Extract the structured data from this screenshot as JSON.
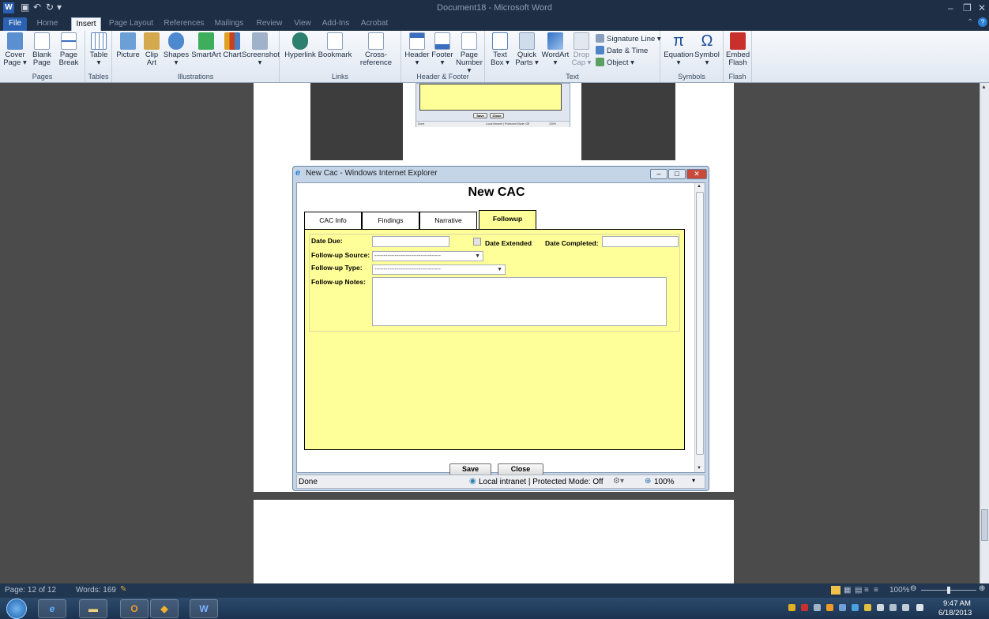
{
  "window": {
    "title": "Document18 - Microsoft Word",
    "app_icon": "W",
    "qa_icons": [
      "save-icon",
      "undo-icon",
      "redo-icon",
      "customize-icon"
    ]
  },
  "tabs": [
    "File",
    "Home",
    "Insert",
    "Page Layout",
    "References",
    "Mailings",
    "Review",
    "View",
    "Add-Ins",
    "Acrobat"
  ],
  "ribbon": {
    "groups": [
      {
        "label": "Pages",
        "buttons": [
          {
            "l1": "Cover",
            "l2": "Page ▾"
          },
          {
            "l1": "Blank",
            "l2": "Page"
          },
          {
            "l1": "Page",
            "l2": "Break"
          }
        ]
      },
      {
        "label": "Tables",
        "buttons": [
          {
            "l1": "Table",
            "l2": "▾"
          }
        ]
      },
      {
        "label": "Illustrations",
        "buttons": [
          {
            "l1": "Picture",
            "l2": ""
          },
          {
            "l1": "Clip",
            "l2": "Art"
          },
          {
            "l1": "Shapes",
            "l2": "▾"
          },
          {
            "l1": "SmartArt",
            "l2": ""
          },
          {
            "l1": "Chart",
            "l2": ""
          },
          {
            "l1": "Screenshot",
            "l2": "▾"
          }
        ]
      },
      {
        "label": "Links",
        "buttons": [
          {
            "l1": "Hyperlink",
            "l2": ""
          },
          {
            "l1": "Bookmark",
            "l2": ""
          },
          {
            "l1": "Cross-reference",
            "l2": ""
          }
        ]
      },
      {
        "label": "Header & Footer",
        "buttons": [
          {
            "l1": "Header",
            "l2": "▾"
          },
          {
            "l1": "Footer",
            "l2": "▾"
          },
          {
            "l1": "Page",
            "l2": "Number ▾"
          }
        ]
      },
      {
        "label": "Text",
        "buttons": [
          {
            "l1": "Text",
            "l2": "Box ▾"
          },
          {
            "l1": "Quick",
            "l2": "Parts ▾"
          },
          {
            "l1": "WordArt",
            "l2": "▾"
          },
          {
            "l1": "Drop",
            "l2": "Cap ▾"
          }
        ],
        "small": [
          "Signature Line ▾",
          "Date & Time",
          "Object ▾"
        ]
      },
      {
        "label": "Symbols",
        "buttons": [
          {
            "l1": "Equation",
            "l2": "▾"
          },
          {
            "l1": "Symbol",
            "l2": "▾"
          }
        ]
      },
      {
        "label": "Flash",
        "buttons": [
          {
            "l1": "Embed",
            "l2": "Flash"
          }
        ]
      }
    ]
  },
  "ie": {
    "title": "New Cac - Windows Internet Explorer",
    "heading": "New CAC",
    "tabs": [
      "CAC Info",
      "Findings",
      "Narrative",
      "Followup"
    ],
    "fields": {
      "date_due": "Date Due:",
      "date_extended": "Date Extended",
      "date_completed": "Date Completed:",
      "source": "Follow-up Source:",
      "type": "Follow-up Type:",
      "notes": "Follow-up Notes:",
      "dash": "------------------------------------"
    },
    "buttons": {
      "save": "Save",
      "close": "Close"
    },
    "status": {
      "done": "Done",
      "zone": "Local intranet | Protected Mode: Off",
      "zoom": "100%"
    }
  },
  "thumb": {
    "save": "Save",
    "close": "Close",
    "done": "Done",
    "zone": "Local intranet | Protected Mode: Off",
    "zoom": "100%"
  },
  "statusbar": {
    "page": "Page: 12 of 12",
    "words": "Words: 169",
    "zoom": "100%"
  },
  "clock": {
    "time": "9:47 AM",
    "date": "6/18/2013"
  },
  "colors": {
    "accent": "#2a61b0",
    "form_bg": "#ffff99"
  }
}
